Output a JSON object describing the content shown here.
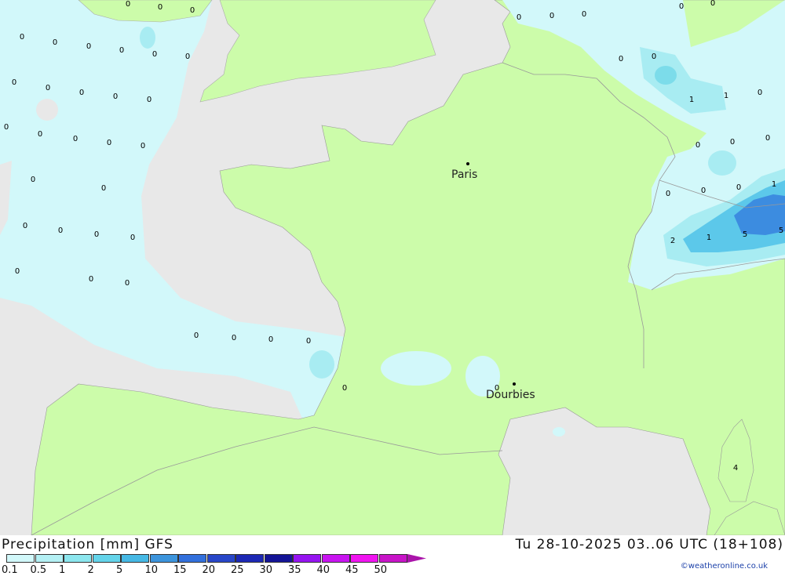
{
  "map": {
    "cities": [
      {
        "name": "Paris"
      },
      {
        "name": "Dourbies"
      }
    ],
    "precip_labels": [
      "0",
      "0",
      "0",
      "0",
      "0",
      "0",
      "0",
      "0",
      "0",
      "0",
      "0",
      "0",
      "0",
      "0",
      "0",
      "0",
      "0",
      "0",
      "0",
      "0",
      "0",
      "0",
      "0",
      "0",
      "0",
      "0",
      "0",
      "0",
      "0",
      "0",
      "0",
      "0",
      "0",
      "0",
      "0",
      "0",
      "0",
      "0",
      "0",
      "0",
      "0",
      "1",
      "1",
      "0",
      "0",
      "0",
      "0",
      "0",
      "0",
      "0",
      "1",
      "2",
      "1",
      "5",
      "5",
      "4",
      "0",
      "0",
      "0"
    ],
    "colors": {
      "sea": "#e8e8e8",
      "land": "#ccfcaa",
      "precip_light": "#d2f8fa",
      "precip_mid": "#a8ecf2",
      "precip_heavy": "#5cc8ea",
      "precip_max": "#3c8ce0"
    }
  },
  "footer": {
    "title_left": "Precipitation [mm] GFS",
    "title_right": "Tu 28-10-2025 03..06 UTC (18+108)",
    "credit": "©weatheronline.co.uk",
    "legend": {
      "ticks": [
        "0.1",
        "0.5",
        "1",
        "2",
        "5",
        "10",
        "15",
        "20",
        "25",
        "30",
        "35",
        "40",
        "45",
        "50"
      ],
      "colors": [
        "#d2f8fa",
        "#b4f0f4",
        "#8ce6ee",
        "#64d4ea",
        "#46b8e4",
        "#3c94dc",
        "#3270dc",
        "#2846c8",
        "#1c28b4",
        "#141496",
        "#9614f0",
        "#c814f0",
        "#f014f0",
        "#c814c8",
        "#aa14aa"
      ]
    }
  }
}
